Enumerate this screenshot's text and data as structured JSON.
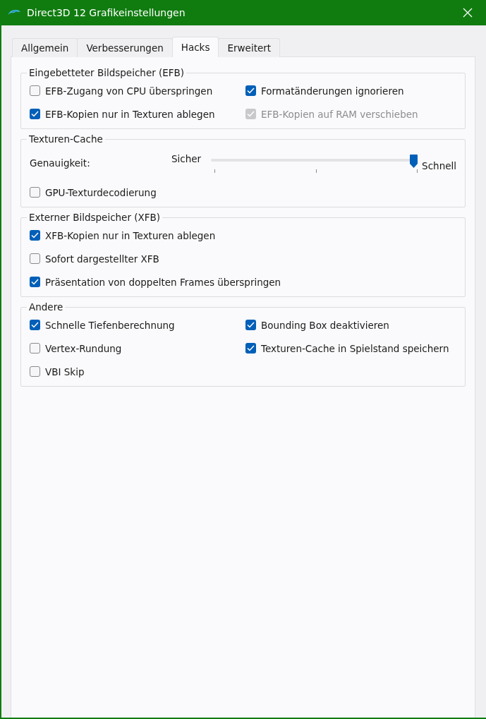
{
  "window": {
    "title": "Direct3D 12 Grafikeinstellungen"
  },
  "tabs": [
    {
      "label": "Allgemein",
      "selected": false
    },
    {
      "label": "Verbesserungen",
      "selected": false
    },
    {
      "label": "Hacks",
      "selected": true
    },
    {
      "label": "Erweitert",
      "selected": false
    }
  ],
  "groups": [
    {
      "title": "Eingebetteter Bildspeicher (EFB)",
      "kind": "two-column",
      "items": [
        {
          "kind": "checkbox",
          "label": "EFB-Zugang von CPU überspringen",
          "checked": false,
          "disabled": false
        },
        {
          "kind": "checkbox",
          "label": "Formatänderungen ignorieren",
          "checked": true,
          "disabled": false
        },
        {
          "kind": "checkbox",
          "label": "EFB-Kopien nur in Texturen ablegen",
          "checked": true,
          "disabled": false
        },
        {
          "kind": "checkbox",
          "label": "EFB-Kopien auf RAM verschieben",
          "checked": true,
          "disabled": true
        }
      ]
    },
    {
      "title": "Texturen-Cache",
      "kind": "one-column",
      "items": [
        {
          "kind": "slider",
          "label": "Genauigkeit:",
          "min_label": "Sicher",
          "max_label": "Schnell",
          "level": 1
        },
        {
          "kind": "checkbox",
          "label": "GPU-Texturdecodierung",
          "checked": false,
          "disabled": false
        }
      ]
    },
    {
      "title": "Externer Bildspeicher (XFB)",
      "kind": "one-column",
      "items": [
        {
          "kind": "checkbox",
          "label": "XFB-Kopien nur in Texturen ablegen",
          "checked": true,
          "disabled": false
        },
        {
          "kind": "checkbox",
          "label": "Sofort dargestellter XFB",
          "checked": false,
          "disabled": false
        },
        {
          "kind": "checkbox",
          "label": "Präsentation von doppelten Frames überspringen",
          "checked": true,
          "disabled": false
        }
      ]
    },
    {
      "title": "Andere",
      "kind": "two-column",
      "items": [
        {
          "kind": "checkbox",
          "label": "Schnelle Tiefenberechnung",
          "checked": true,
          "disabled": false
        },
        {
          "kind": "checkbox",
          "label": "Bounding Box deaktivieren",
          "checked": true,
          "disabled": false
        },
        {
          "kind": "checkbox",
          "label": "Vertex-Rundung",
          "checked": false,
          "disabled": false
        },
        {
          "kind": "checkbox",
          "label": "Texturen-Cache in Spielstand speichern",
          "checked": true,
          "disabled": false
        },
        {
          "kind": "checkbox",
          "label": "VBI Skip",
          "checked": false,
          "disabled": false
        }
      ]
    }
  ]
}
